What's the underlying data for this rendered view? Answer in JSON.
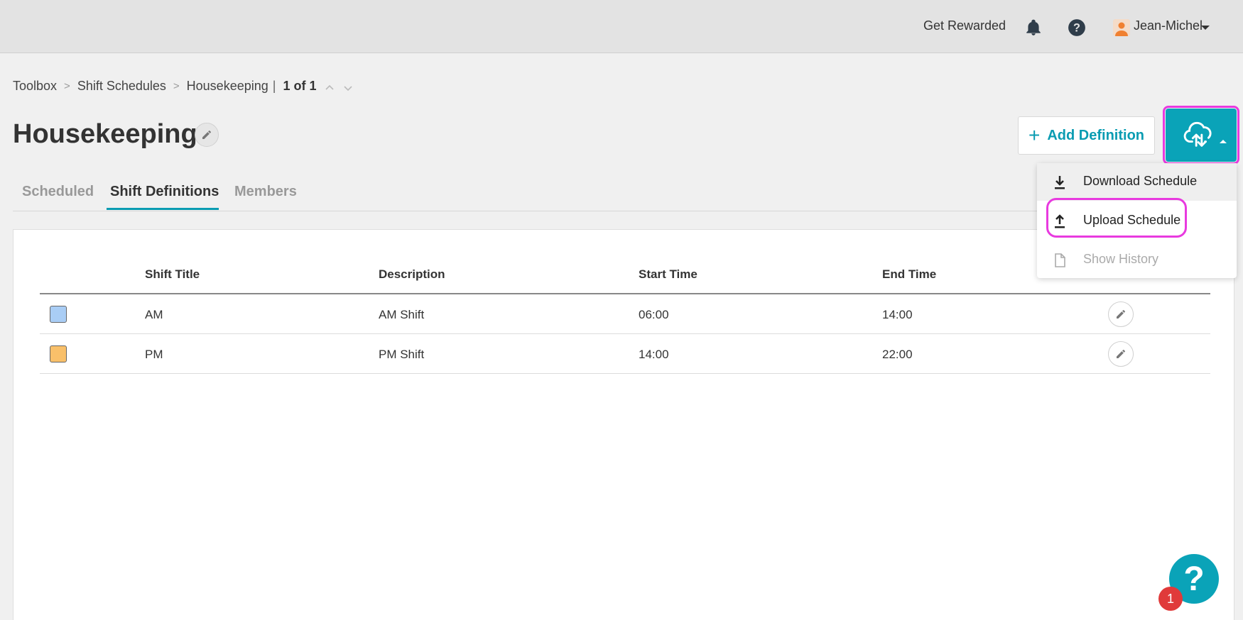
{
  "topbar": {
    "rewarded_label": "Get Rewarded",
    "username": "Jean-Michel",
    "icons": [
      "bell-icon",
      "help-circle-icon",
      "avatar",
      "chevron-down-icon"
    ]
  },
  "breadcrumb": {
    "items": [
      "Toolbox",
      "Shift Schedules",
      "Housekeeping"
    ],
    "separator": ">",
    "pager": "1 of 1"
  },
  "page": {
    "title": "Housekeeping"
  },
  "actions": {
    "add_definition_label": "Add Definition",
    "upload_menu_icon": "cloud-upload-download-icon"
  },
  "tabs": [
    {
      "label": "Scheduled",
      "active": false
    },
    {
      "label": "Shift Definitions",
      "active": true
    },
    {
      "label": "Members",
      "active": false
    }
  ],
  "table": {
    "columns": [
      "",
      "Shift Title",
      "Description",
      "Start Time",
      "End Time",
      ""
    ],
    "rows": [
      {
        "color": "#a9cdf5",
        "title": "AM",
        "description": "AM Shift",
        "start": "06:00",
        "end": "14:00"
      },
      {
        "color": "#f9c06a",
        "title": "PM",
        "description": "PM Shift",
        "start": "14:00",
        "end": "22:00"
      }
    ]
  },
  "dropdown": {
    "items": [
      {
        "label": "Download Schedule",
        "icon": "download-icon",
        "enabled": true
      },
      {
        "label": "Upload Schedule",
        "icon": "upload-icon",
        "enabled": true
      },
      {
        "label": "Show History",
        "icon": "document-icon",
        "enabled": false
      }
    ]
  },
  "help_widget": {
    "icon": "?",
    "badge_count": "1"
  },
  "colors": {
    "accent": "#0aa3b8",
    "highlight": "#e83adf"
  }
}
